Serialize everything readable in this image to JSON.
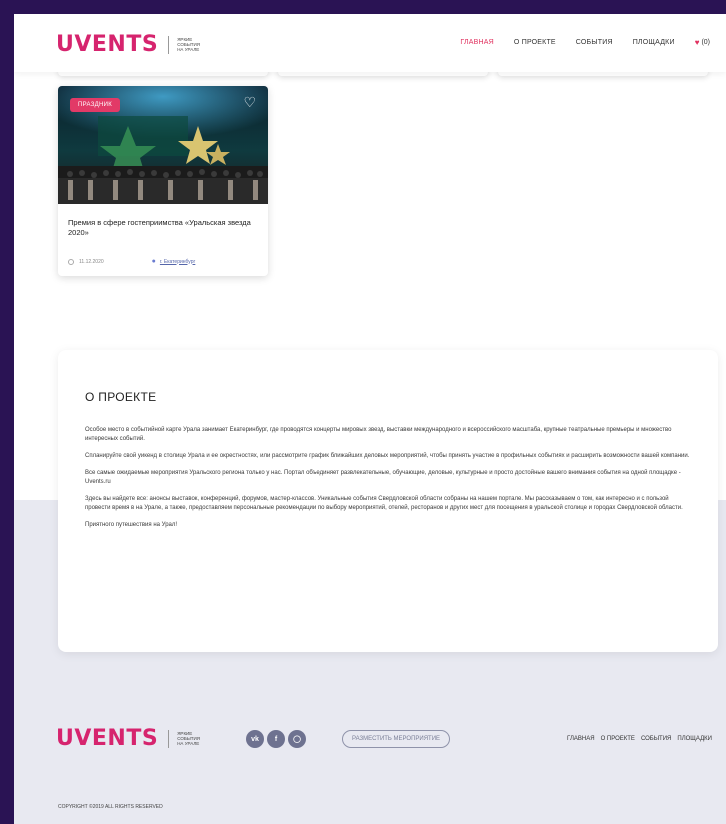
{
  "brand": {
    "logo": "UVENTS",
    "tagline": "Яркие события на Урале",
    "accent": "#d6246e"
  },
  "nav": {
    "items": [
      {
        "label": "ГЛАВНАЯ",
        "active": true
      },
      {
        "label": "О ПРОЕКТЕ"
      },
      {
        "label": "СОБЫТИЯ"
      },
      {
        "label": "ПЛОЩАДКИ"
      }
    ],
    "favorites": "(0)"
  },
  "event": {
    "badge": "ПРАЗДНИК",
    "title": "Премия в сфере гостеприимства «Уральская звезда 2020»",
    "date": "11.12.2020",
    "city": "г. Екатеринбург"
  },
  "about": {
    "title": "О ПРОЕКТЕ",
    "paragraphs": [
      "Особое место в событийной карте Урала занимает Екатеринбург, где проводятся концерты мировых звезд, выставки международного и всероссийского масштаба, крупные театральные премьеры и множество интересных событий.",
      "Спланируйте свой уикенд в столице Урала и ее окрестностях, или рассмотрите график ближайших деловых мероприятий, чтобы принять участие в профильных событиях и расширить возможности вашей компании.",
      "Все самые ожидаемые мероприятия Уральского региона только у нас. Портал объединяет развлекательные, обучающие, деловые, культурные и просто достойные вашего внимания события на одной площадке - Uvents.ru",
      "Здесь вы найдете все: анонсы выставок, конференций, форумов, мастер-классов. Уникальные события Свердловской области собраны на нашем портале. Мы рассказываем о том, как интересно и с пользой провести время в на Урале, а также, предоставляем персональные рекомендации по выбору мероприятий, отелей, ресторанов и других мест для посещения в уральской столице и городах Свердловской области.",
      "Приятного путешествия на Урал!"
    ]
  },
  "footer": {
    "place_button": "РАЗМЕСТИТЬ МЕРОПРИЯТИЕ",
    "nav": [
      "ГЛАВНАЯ",
      "О ПРОЕКТЕ",
      "СОБЫТИЯ",
      "ПЛОЩАДКИ"
    ],
    "copyright": "COPYRIGHT ©2019 ALL RIGHTS RESERVED",
    "social": [
      "vk-icon",
      "facebook-icon",
      "instagram-icon"
    ]
  }
}
